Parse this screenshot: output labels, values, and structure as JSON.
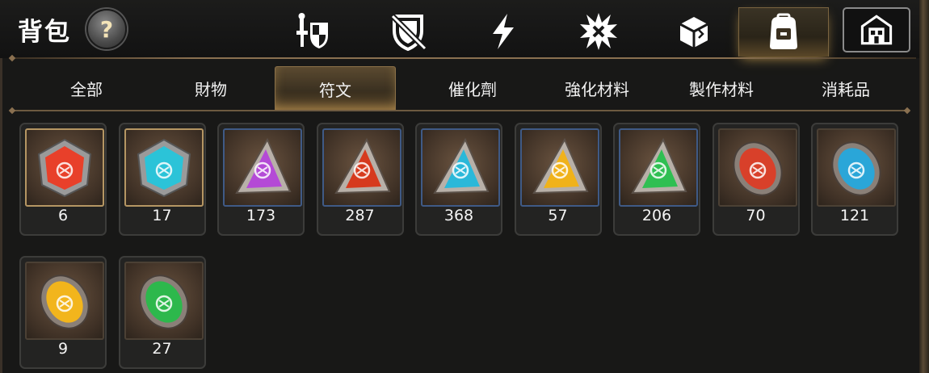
{
  "header": {
    "title": "背包",
    "help_glyph": "?",
    "category_tabs": [
      {
        "icon": "knight-shield-icon",
        "active": false
      },
      {
        "icon": "broken-shield-icon",
        "active": false
      },
      {
        "icon": "lightning-bolt-icon",
        "active": false
      },
      {
        "icon": "explosion-icon",
        "active": false
      },
      {
        "icon": "broken-box-icon",
        "active": false
      },
      {
        "icon": "backpack-icon",
        "active": true
      },
      {
        "icon": "warehouse-icon",
        "active": false
      }
    ]
  },
  "subtabs": [
    "全部",
    "財物",
    "符文",
    "催化劑",
    "強化材料",
    "製作材料",
    "消耗品"
  ],
  "active_subtab": 2,
  "items": [
    {
      "name": "red-pentagon-rune",
      "color": "#e8402a",
      "shape": "pentagon",
      "count": "6"
    },
    {
      "name": "cyan-pentagon-rune",
      "color": "#2bc3d8",
      "shape": "pentagon",
      "count": "17"
    },
    {
      "name": "purple-triangle-rune",
      "color": "#b44ad6",
      "shape": "triangle",
      "count": "173"
    },
    {
      "name": "red-triangle-rune",
      "color": "#d63a1e",
      "shape": "triangle",
      "count": "287"
    },
    {
      "name": "cyan-triangle-rune",
      "color": "#2ab8d9",
      "shape": "triangle",
      "count": "368"
    },
    {
      "name": "yellow-triangle-rune",
      "color": "#f0b21a",
      "shape": "triangle",
      "count": "57"
    },
    {
      "name": "green-triangle-rune",
      "color": "#2fbf52",
      "shape": "triangle",
      "count": "206"
    },
    {
      "name": "red-oval-rune",
      "color": "#d8402a",
      "shape": "oval",
      "count": "70"
    },
    {
      "name": "cyan-oval-rune",
      "color": "#2aa6d8",
      "shape": "oval",
      "count": "121"
    },
    {
      "name": "yellow-oval-rune",
      "color": "#f2b51c",
      "shape": "oval",
      "count": "9"
    },
    {
      "name": "green-oval-rune",
      "color": "#2db84c",
      "shape": "oval",
      "count": "27"
    }
  ]
}
